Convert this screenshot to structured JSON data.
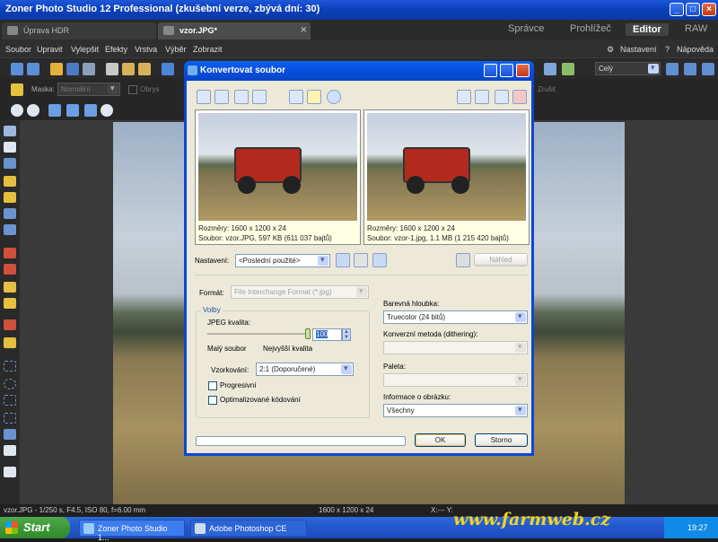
{
  "app": {
    "title": "Zoner Photo Studio 12 Professional (zkušební verze, zbývá dní: 30)",
    "tabs": [
      {
        "label": "Úprava HDR"
      },
      {
        "label": "vzor.JPG*"
      }
    ],
    "modes": [
      "Správce",
      "Prohlížeč",
      "Editor",
      "RAW"
    ],
    "menu": [
      "Soubor",
      "Upravit",
      "Vylepšit",
      "Efekty",
      "Vrstva",
      "Výběr",
      "Zobrazit"
    ],
    "right_menu": {
      "settings": "Nastavení",
      "help": "Nápověda"
    },
    "toolbar": {
      "view_select": "Celý",
      "mask_label": "Maska:",
      "mask_value": "Normální",
      "outline_label": "Obrys",
      "cancel_btn": "Zrušit"
    }
  },
  "dialog": {
    "title": "Konvertovat soubor",
    "left_preview": {
      "dimensions": "Rozměry: 1600 x 1200 x 24",
      "file": "Soubor: vzor.JPG, 597 KB (611 037 bajtů)"
    },
    "right_preview": {
      "dimensions": "Rozměry: 1600 x 1200 x 24",
      "file": "Soubor: vzor-1.jpg, 1.1 MB (1 215 420 bajtů)"
    },
    "settings_label": "Nastavení:",
    "settings_value": "<Poslední použité>",
    "preview_button": "Náhled",
    "format_label": "Formát:",
    "format_value": "File Interchange Format (*.jpg)",
    "options_group": "Volby",
    "jpeg_quality_label": "JPEG kvalita:",
    "jpeg_quality_value": "100",
    "jpeg_quality_level": 1.0,
    "small_file_label": "Malý soubor",
    "high_quality_label": "Nejvyšší kvalita",
    "sampling_label": "Vzorkování:",
    "sampling_value": "2:1 (Doporučené)",
    "progressive_label": "Progresivní",
    "optimized_label": "Optimalizované kódování",
    "color_depth_label": "Barevná hloubka:",
    "color_depth_value": "Truecolor (24 bitů)",
    "dithering_label": "Konverzní metoda (dithering):",
    "dithering_value": "",
    "palette_label": "Paleta:",
    "palette_value": "",
    "info_label": "Informace o obrázku:",
    "info_value": "Všechny",
    "ok_button": "OK",
    "cancel_button": "Storno"
  },
  "status": {
    "left": "vzor.JPG - 1/250 s, F4.5, ISO 80, f=6.00 mm",
    "dimensions": "1600 x 1200 x 24",
    "coord": "X:--- Y:"
  },
  "taskbar": {
    "start": "Start",
    "tasks": [
      "Zoner Photo Studio 1...",
      "Adobe Photoshop CE"
    ],
    "clock": "19:27"
  },
  "watermark": "www.farmweb.cz"
}
